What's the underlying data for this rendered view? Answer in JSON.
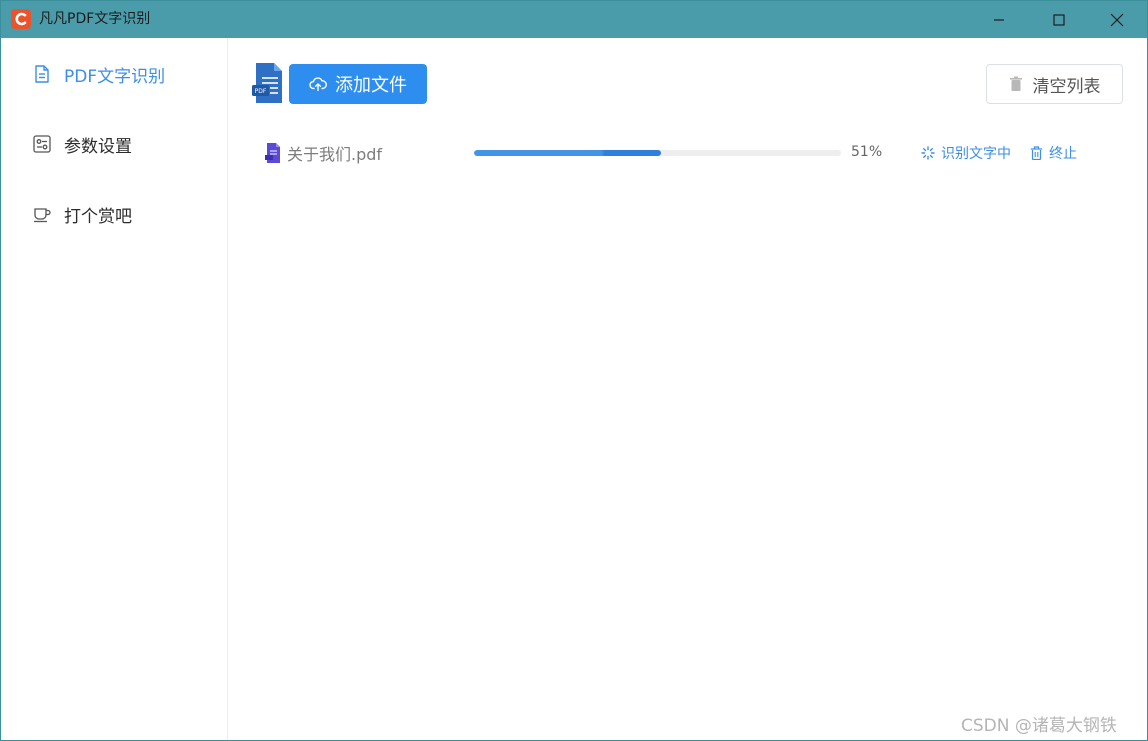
{
  "window": {
    "title": "凡凡PDF文字识别",
    "logo_letter": "C",
    "accent_color": "#4a9cab"
  },
  "sidebar": {
    "items": [
      {
        "label": "PDF文字识别",
        "icon": "document-icon",
        "active": true
      },
      {
        "label": "参数设置",
        "icon": "settings-sliders-icon",
        "active": false
      },
      {
        "label": "打个赏吧",
        "icon": "coffee-cup-icon",
        "active": false
      }
    ]
  },
  "toolbar": {
    "add_label": "添加文件",
    "clear_label": "清空列表",
    "pdf_badge": "PDF"
  },
  "files": [
    {
      "name": "关于我们.pdf",
      "progress": 51,
      "progress_text": "51%",
      "status": "识别文字中",
      "stop_label": "终止"
    }
  ],
  "watermark": "CSDN @诸葛大钢铁",
  "colors": {
    "primary": "#2e8ef0",
    "link": "#3d8ee6",
    "titlebar": "#4a9cab"
  }
}
